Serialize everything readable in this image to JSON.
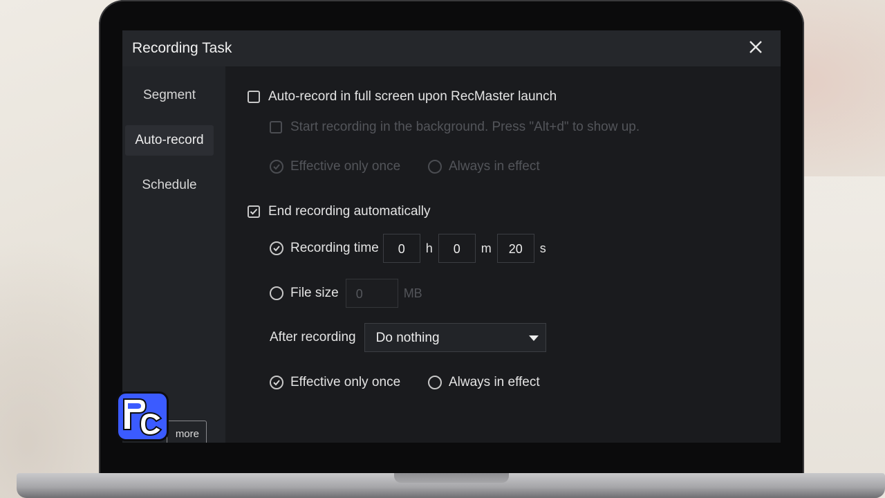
{
  "window": {
    "title": "Recording Task"
  },
  "sidebar": {
    "items": [
      {
        "label": "Segment"
      },
      {
        "label": "Auto-record"
      },
      {
        "label": "Schedule"
      }
    ],
    "more_label": "more"
  },
  "auto_record": {
    "fullscreen_label": "Auto-record in full screen upon RecMaster launch",
    "fullscreen_checked": false,
    "background_label": "Start recording in the background. Press \"Alt+d\" to show up.",
    "background_checked": false,
    "effective_once_label": "Effective only once",
    "always_label": "Always in effect"
  },
  "end_recording": {
    "label": "End recording automatically",
    "checked": true,
    "recording_time_label": "Recording time",
    "hours": "0",
    "hours_unit": "h",
    "minutes": "0",
    "minutes_unit": "m",
    "seconds": "20",
    "seconds_unit": "s",
    "file_size_label": "File size",
    "file_size_value": "0",
    "file_size_unit": "MB",
    "after_recording_label": "After recording",
    "after_recording_value": "Do nothing",
    "effective_once_label": "Effective only once",
    "always_label": "Always in effect"
  },
  "colors": {
    "window_bg": "#1a1b1e",
    "titlebar_bg": "#25272b",
    "sidebar_bg": "#222428",
    "logo_blue": "#3b5bff"
  }
}
